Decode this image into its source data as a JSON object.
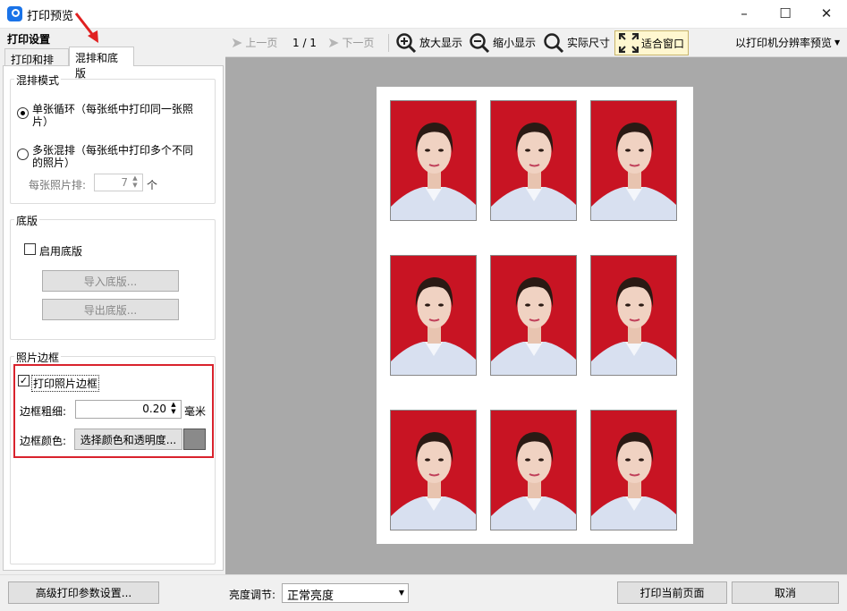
{
  "window": {
    "title": "打印预览"
  },
  "left": {
    "settings_title": "打印设置",
    "tabs": [
      "打印和排版",
      "混排和底版"
    ],
    "mix_mode": {
      "group_label": "混排模式",
      "option1": "单张循环（每张纸中打印同一张照",
      "option1_cont": "片）",
      "option2": "多张混排（每张纸中打印多个不同",
      "option2_cont": "的照片）",
      "per_sheet_label": "每张照片排:",
      "per_sheet_value": "7",
      "per_sheet_unit": "个"
    },
    "template": {
      "group_label": "底版",
      "enable_label": "启用底版",
      "import_label": "导入底版...",
      "export_label": "导出底版..."
    },
    "border": {
      "group_label": "照片边框",
      "print_border_label": "打印照片边框",
      "width_label": "边框粗细:",
      "width_value": "0.20",
      "width_unit": "毫米",
      "color_label": "边框颜色:",
      "choose_color_label": "选择颜色和透明度...",
      "swatch_color": "#8a8a8a",
      "highlight_color": "#d9232d"
    }
  },
  "toolbar": {
    "prev": "上一页",
    "page": "1 / 1",
    "next": "下一页",
    "zoom_in": "放大显示",
    "zoom_out": "缩小显示",
    "actual_size": "实际尺寸",
    "fit_window": "适合窗口",
    "printer_preview": "以打印机分辨率预览"
  },
  "bottom": {
    "advanced": "高级打印参数设置...",
    "brightness_label": "亮度调节:",
    "brightness_value": "正常亮度",
    "print_current": "打印当前页面",
    "cancel": "取消"
  }
}
